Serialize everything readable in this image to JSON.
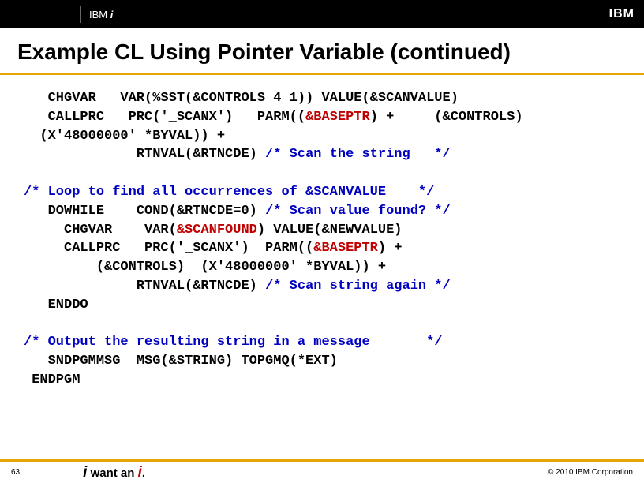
{
  "header": {
    "brand_prefix": "IBM ",
    "brand_suffix": "i",
    "logo_text": "IBM"
  },
  "title": "Example CL Using Pointer Variable  (continued)",
  "code": {
    "l1a": "   CHGVAR   VAR(%SST(&CONTROLS 4 1)) VALUE(&SCANVALUE)",
    "l2a": "   CALLPRC   PRC('_SCANX')   PARM((",
    "l2b": "&BASEPTR",
    "l2c": ") +     (&CONTROLS)",
    "l3a": "  (X'48000000' *BYVAL)) +",
    "l4a": "              RTNVAL(&RTNCDE) ",
    "l4b": "/* Scan the string   */",
    "l5a": "/* Loop to find all occurrences of &SCANVALUE    */",
    "l6a": "   DOWHILE    COND(&RTNCDE=0) ",
    "l6b": "/* Scan value found? */",
    "l7a": "     CHGVAR    VAR(",
    "l7b": "&SCANFOUND",
    "l7c": ") VALUE(&NEWVALUE)",
    "l8a": "     CALLPRC   PRC('_SCANX')  PARM((",
    "l8b": "&BASEPTR",
    "l8c": ")",
    "l8d": " +",
    "l9a": "         (&CONTROLS)  (X'48000000' *BYVAL)) +",
    "l10a": "              RTNVAL(&RTNCDE) ",
    "l10b": "/* Scan string again */",
    "l11a": "   ENDDO",
    "l12a": "/* Output the resulting string in a message       */",
    "l13a": "   SNDPGMMSG  MSG(&STRING) TOPGMQ(*EXT)",
    "l14a": " ENDPGM"
  },
  "footer": {
    "page": "63",
    "tag_i1": "i",
    "tag_mid": " want an ",
    "tag_i2": "i",
    "tag_dot": ".",
    "copyright": "© 2010 IBM Corporation"
  }
}
